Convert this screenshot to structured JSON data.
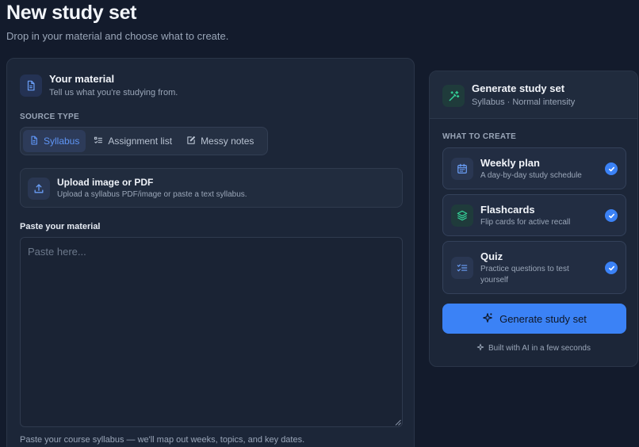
{
  "header": {
    "title": "New study set",
    "subtitle": "Drop in your material and choose what to create."
  },
  "material": {
    "title": "Your material",
    "subtitle": "Tell us what you're studying from.",
    "source_type_label": "SOURCE TYPE",
    "source_types": [
      {
        "label": "Syllabus",
        "icon": "document-icon",
        "active": true
      },
      {
        "label": "Assignment list",
        "icon": "checklist-icon",
        "active": false
      },
      {
        "label": "Messy notes",
        "icon": "edit-note-icon",
        "active": false
      }
    ],
    "upload": {
      "title": "Upload image or PDF",
      "subtitle": "Upload a syllabus PDF/image or paste a text syllabus."
    },
    "paste_label": "Paste your material",
    "paste_placeholder": "Paste here...",
    "hint": "Paste your course syllabus — we'll map out weeks, topics, and key dates."
  },
  "generate": {
    "title": "Generate study set",
    "subtitle": "Syllabus · Normal intensity",
    "what_to_create_label": "WHAT TO CREATE",
    "options": [
      {
        "title": "Weekly plan",
        "desc": "A day-by-day study schedule",
        "icon": "calendar-icon",
        "checked": true
      },
      {
        "title": "Flashcards",
        "desc": "Flip cards for active recall",
        "icon": "layers-icon",
        "checked": true
      },
      {
        "title": "Quiz",
        "desc": "Practice questions to test yourself",
        "icon": "checklist-icon",
        "checked": true
      }
    ],
    "button_label": "Generate study set",
    "footer": "Built with AI in a few seconds"
  },
  "colors": {
    "accent": "#3b82f6",
    "background": "#131b2c",
    "panel": "#1c2638"
  }
}
